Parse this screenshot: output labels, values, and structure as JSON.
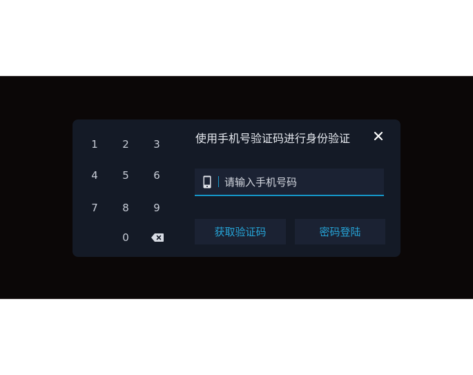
{
  "dialog": {
    "title": "使用手机号验证码进行身份验证",
    "phone_placeholder": "请输入手机号码",
    "get_code_label": "获取验证码",
    "password_login_label": "密码登陆"
  },
  "keypad": {
    "keys": [
      "1",
      "2",
      "3",
      "4",
      "5",
      "6",
      "7",
      "8",
      "9",
      "0"
    ],
    "delete_icon": "backspace-icon"
  },
  "colors": {
    "screen_bg": "#0b0707",
    "dialog_bg": "#141a26",
    "field_bg": "#1b2233",
    "accent": "#1597c9",
    "button_text": "#26a3d6"
  }
}
